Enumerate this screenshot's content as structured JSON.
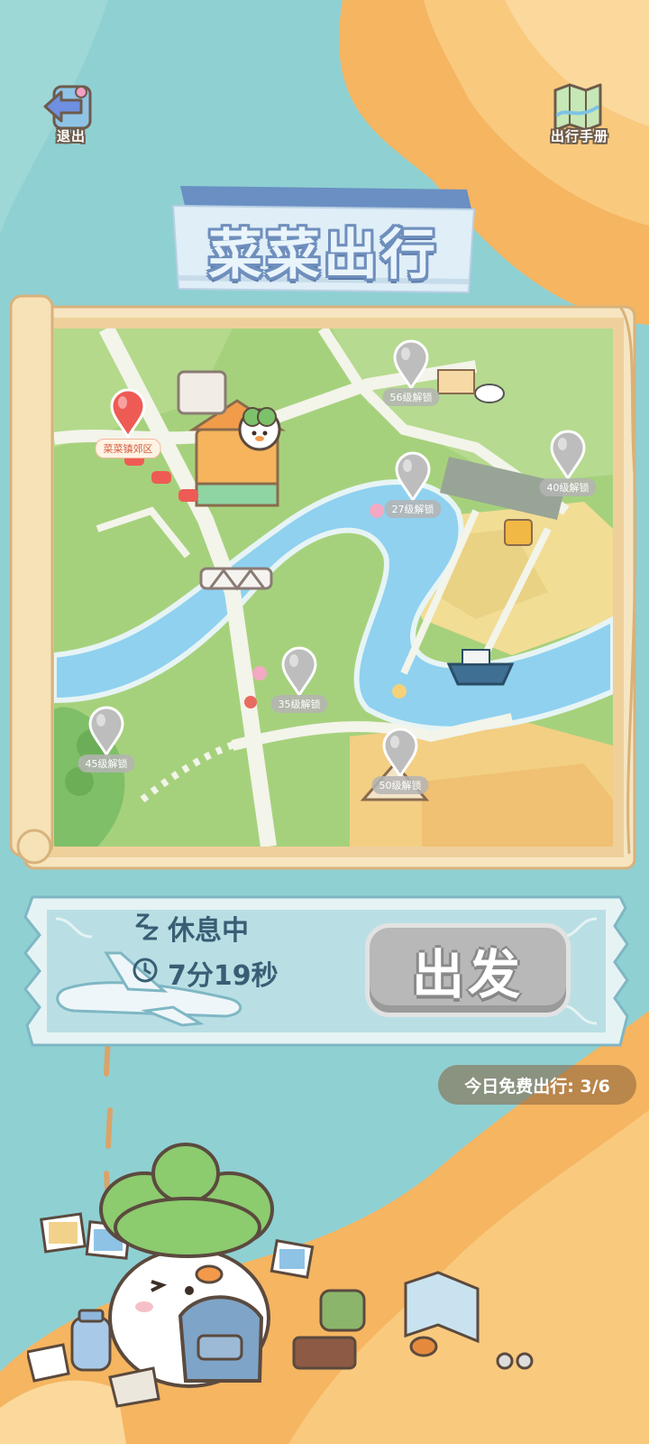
{
  "header": {
    "exit_label": "退出",
    "guide_label": "出行手册"
  },
  "title": "菜菜出行",
  "map": {
    "current_location": "菜菜镇郊区",
    "locked_spots": [
      {
        "label": "56级解锁"
      },
      {
        "label": "40级解锁"
      },
      {
        "label": "27级解锁"
      },
      {
        "label": "35级解锁"
      },
      {
        "label": "45级解锁"
      },
      {
        "label": "50级解锁"
      }
    ]
  },
  "status": {
    "state": "休息中",
    "timer": "7分19秒",
    "depart_label": "出发"
  },
  "free_trips": "今日免费出行: 3/6",
  "colors": {
    "sea": "#8fd0d3",
    "sand": "#f4b766",
    "map_grass": "#a6d17c",
    "river": "#8fd1ef",
    "panel": "#b9dfe5",
    "disabled_button": "#b8b8b8",
    "active_pin": "#ee5b55"
  }
}
